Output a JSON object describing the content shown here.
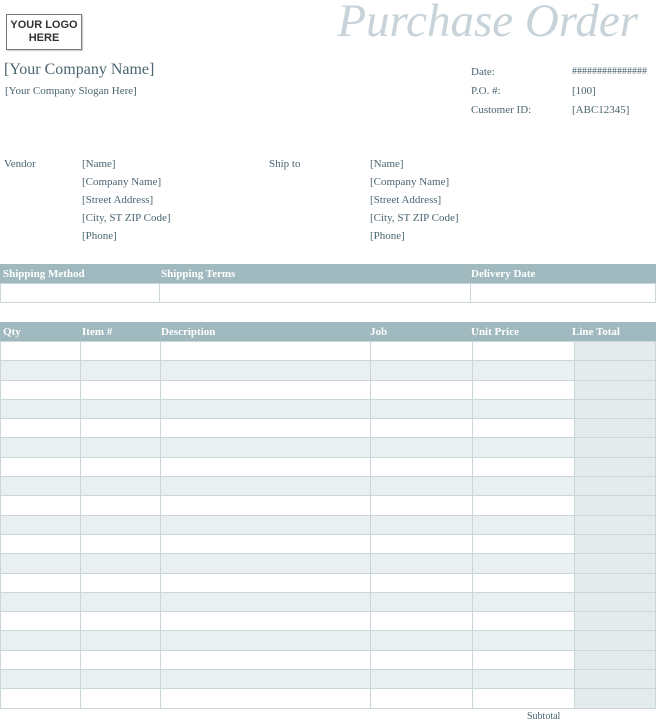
{
  "logo": {
    "text": "YOUR LOGO HERE"
  },
  "title": "Purchase Order",
  "company": {
    "name": "[Your Company Name]",
    "slogan": "[Your Company Slogan Here]"
  },
  "meta": [
    {
      "label": "Date:",
      "value": "###############"
    },
    {
      "label": "P.O. #:",
      "value": "[100]"
    },
    {
      "label": "Customer ID:",
      "value": "[ABC12345]"
    }
  ],
  "vendor": {
    "label": "Vendor",
    "lines": [
      "[Name]",
      "[Company Name]",
      "[Street Address]",
      "[City, ST  ZIP Code]",
      "[Phone]"
    ]
  },
  "ship_to": {
    "label": "Ship to",
    "lines": [
      "[Name]",
      "[Company Name]",
      "[Street Address]",
      "[City, ST  ZIP Code]",
      "[Phone]"
    ]
  },
  "shipping_table": {
    "headers": [
      "Shipping Method",
      "Shipping Terms",
      "Delivery Date"
    ]
  },
  "items_table": {
    "headers": [
      "Qty",
      "Item #",
      "Description",
      "Job",
      "Unit Price",
      "Line Total"
    ],
    "row_count": 19
  },
  "colors": {
    "header_bg": "#9fb9bf",
    "stripe": "#eaf0f1",
    "line_total_col": "#e4ebec",
    "text": "#4a6470",
    "title": "#c7d3d8"
  },
  "footer": {
    "subtotal_label": "Subtotal"
  }
}
